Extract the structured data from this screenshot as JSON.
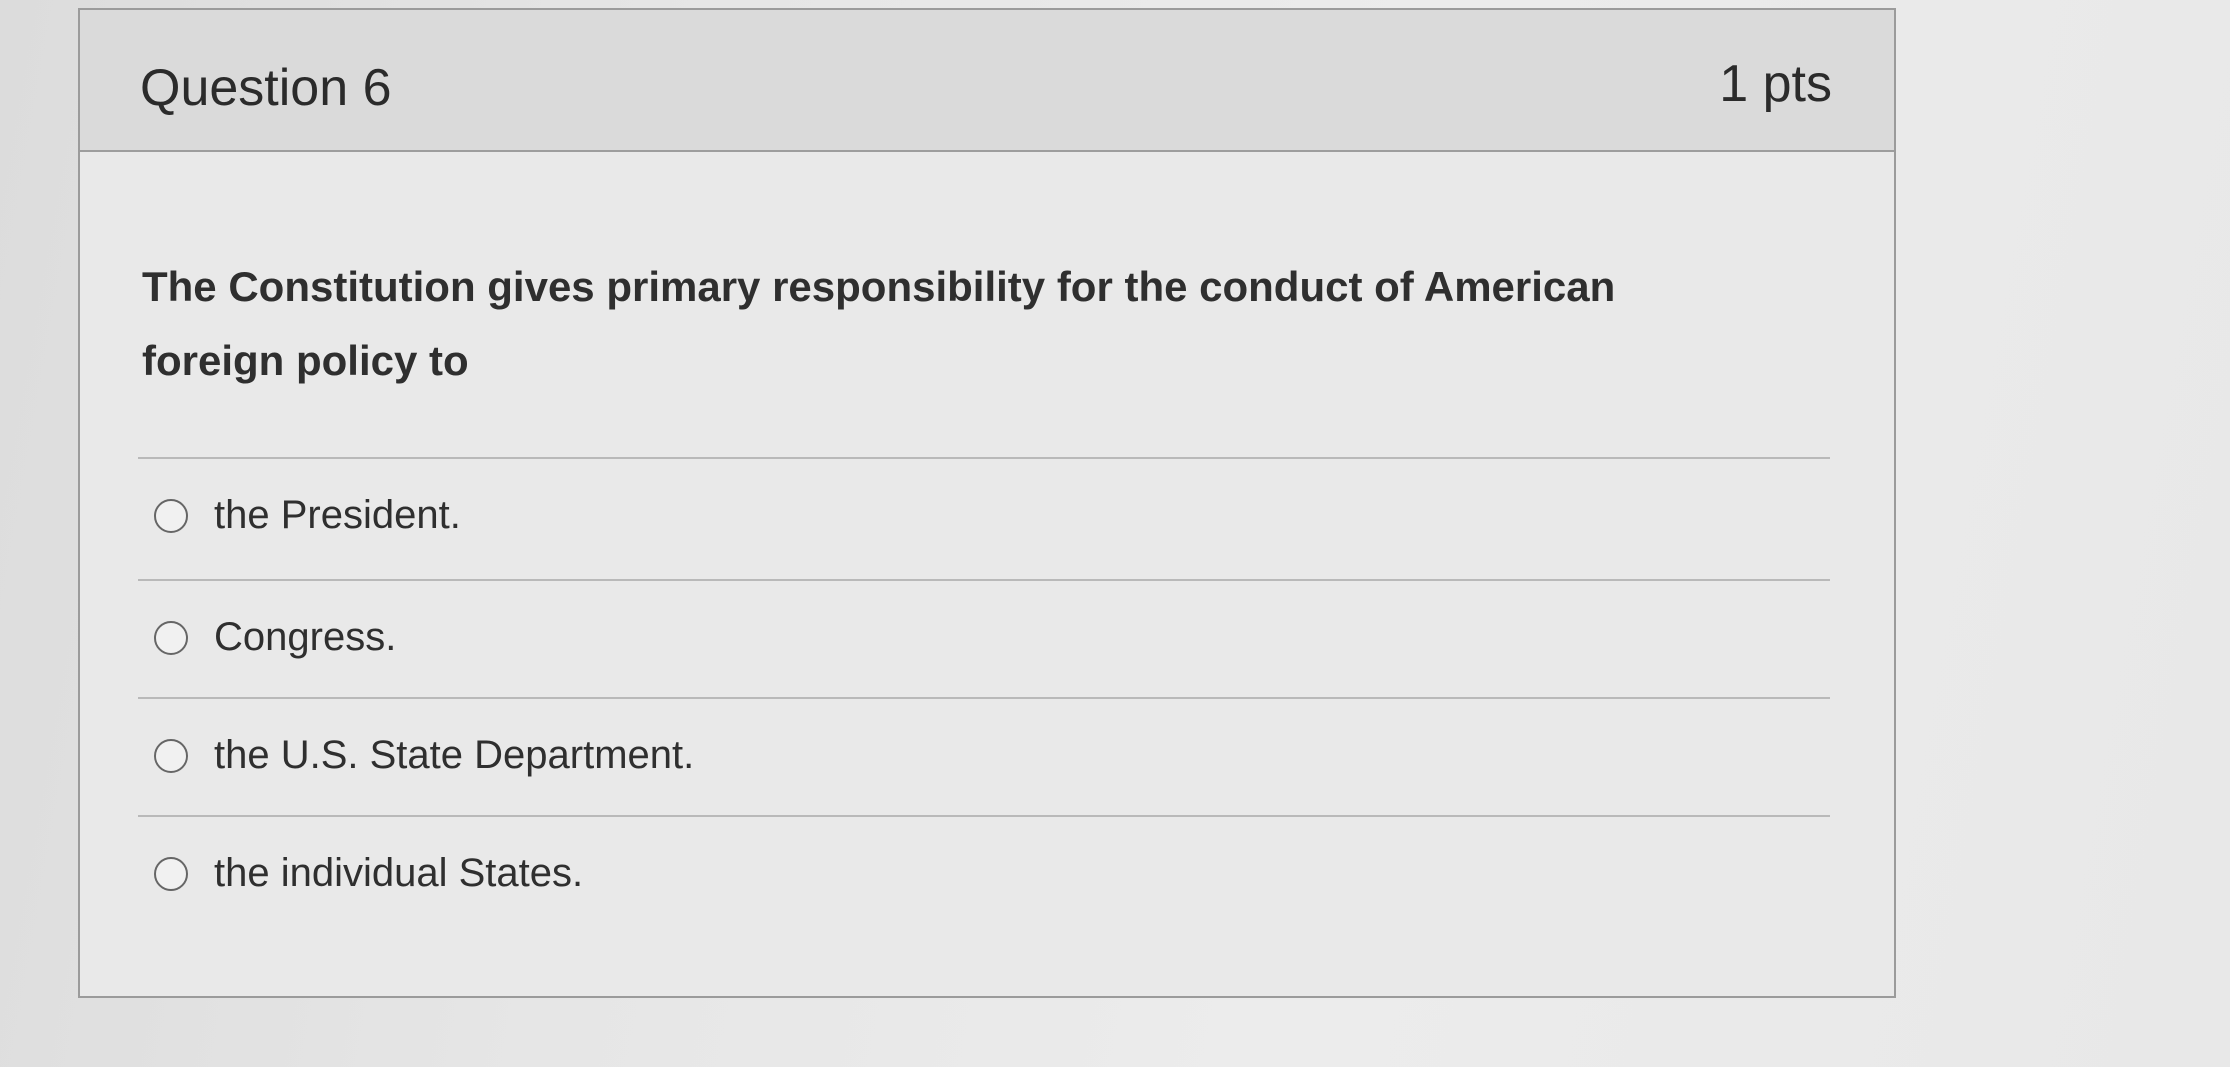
{
  "question": {
    "title": "Question 6",
    "points": "1 pts",
    "text": "The Constitution gives primary responsibility for the conduct of American foreign policy to",
    "answers": [
      "the President.",
      "Congress.",
      "the U.S. State Department.",
      "the individual States."
    ]
  }
}
